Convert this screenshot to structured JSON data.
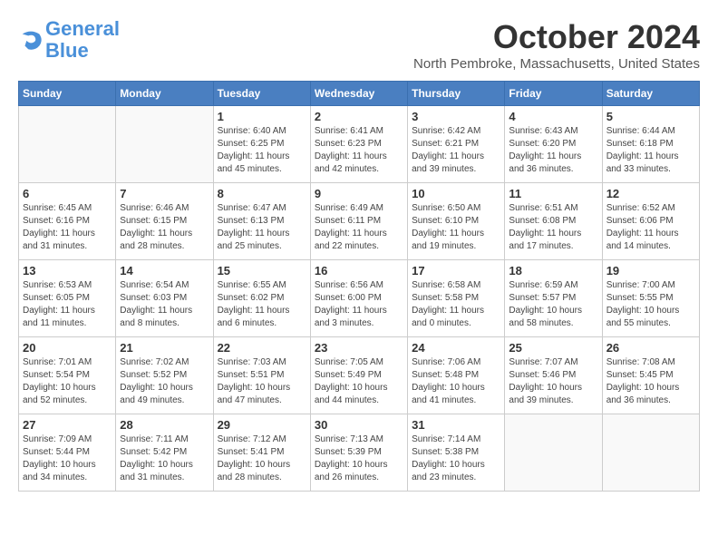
{
  "header": {
    "logo_line1": "General",
    "logo_line2": "Blue",
    "month": "October 2024",
    "location": "North Pembroke, Massachusetts, United States"
  },
  "weekdays": [
    "Sunday",
    "Monday",
    "Tuesday",
    "Wednesday",
    "Thursday",
    "Friday",
    "Saturday"
  ],
  "weeks": [
    [
      {
        "day": "",
        "info": ""
      },
      {
        "day": "",
        "info": ""
      },
      {
        "day": "1",
        "info": "Sunrise: 6:40 AM\nSunset: 6:25 PM\nDaylight: 11 hours and 45 minutes."
      },
      {
        "day": "2",
        "info": "Sunrise: 6:41 AM\nSunset: 6:23 PM\nDaylight: 11 hours and 42 minutes."
      },
      {
        "day": "3",
        "info": "Sunrise: 6:42 AM\nSunset: 6:21 PM\nDaylight: 11 hours and 39 minutes."
      },
      {
        "day": "4",
        "info": "Sunrise: 6:43 AM\nSunset: 6:20 PM\nDaylight: 11 hours and 36 minutes."
      },
      {
        "day": "5",
        "info": "Sunrise: 6:44 AM\nSunset: 6:18 PM\nDaylight: 11 hours and 33 minutes."
      }
    ],
    [
      {
        "day": "6",
        "info": "Sunrise: 6:45 AM\nSunset: 6:16 PM\nDaylight: 11 hours and 31 minutes."
      },
      {
        "day": "7",
        "info": "Sunrise: 6:46 AM\nSunset: 6:15 PM\nDaylight: 11 hours and 28 minutes."
      },
      {
        "day": "8",
        "info": "Sunrise: 6:47 AM\nSunset: 6:13 PM\nDaylight: 11 hours and 25 minutes."
      },
      {
        "day": "9",
        "info": "Sunrise: 6:49 AM\nSunset: 6:11 PM\nDaylight: 11 hours and 22 minutes."
      },
      {
        "day": "10",
        "info": "Sunrise: 6:50 AM\nSunset: 6:10 PM\nDaylight: 11 hours and 19 minutes."
      },
      {
        "day": "11",
        "info": "Sunrise: 6:51 AM\nSunset: 6:08 PM\nDaylight: 11 hours and 17 minutes."
      },
      {
        "day": "12",
        "info": "Sunrise: 6:52 AM\nSunset: 6:06 PM\nDaylight: 11 hours and 14 minutes."
      }
    ],
    [
      {
        "day": "13",
        "info": "Sunrise: 6:53 AM\nSunset: 6:05 PM\nDaylight: 11 hours and 11 minutes."
      },
      {
        "day": "14",
        "info": "Sunrise: 6:54 AM\nSunset: 6:03 PM\nDaylight: 11 hours and 8 minutes."
      },
      {
        "day": "15",
        "info": "Sunrise: 6:55 AM\nSunset: 6:02 PM\nDaylight: 11 hours and 6 minutes."
      },
      {
        "day": "16",
        "info": "Sunrise: 6:56 AM\nSunset: 6:00 PM\nDaylight: 11 hours and 3 minutes."
      },
      {
        "day": "17",
        "info": "Sunrise: 6:58 AM\nSunset: 5:58 PM\nDaylight: 11 hours and 0 minutes."
      },
      {
        "day": "18",
        "info": "Sunrise: 6:59 AM\nSunset: 5:57 PM\nDaylight: 10 hours and 58 minutes."
      },
      {
        "day": "19",
        "info": "Sunrise: 7:00 AM\nSunset: 5:55 PM\nDaylight: 10 hours and 55 minutes."
      }
    ],
    [
      {
        "day": "20",
        "info": "Sunrise: 7:01 AM\nSunset: 5:54 PM\nDaylight: 10 hours and 52 minutes."
      },
      {
        "day": "21",
        "info": "Sunrise: 7:02 AM\nSunset: 5:52 PM\nDaylight: 10 hours and 49 minutes."
      },
      {
        "day": "22",
        "info": "Sunrise: 7:03 AM\nSunset: 5:51 PM\nDaylight: 10 hours and 47 minutes."
      },
      {
        "day": "23",
        "info": "Sunrise: 7:05 AM\nSunset: 5:49 PM\nDaylight: 10 hours and 44 minutes."
      },
      {
        "day": "24",
        "info": "Sunrise: 7:06 AM\nSunset: 5:48 PM\nDaylight: 10 hours and 41 minutes."
      },
      {
        "day": "25",
        "info": "Sunrise: 7:07 AM\nSunset: 5:46 PM\nDaylight: 10 hours and 39 minutes."
      },
      {
        "day": "26",
        "info": "Sunrise: 7:08 AM\nSunset: 5:45 PM\nDaylight: 10 hours and 36 minutes."
      }
    ],
    [
      {
        "day": "27",
        "info": "Sunrise: 7:09 AM\nSunset: 5:44 PM\nDaylight: 10 hours and 34 minutes."
      },
      {
        "day": "28",
        "info": "Sunrise: 7:11 AM\nSunset: 5:42 PM\nDaylight: 10 hours and 31 minutes."
      },
      {
        "day": "29",
        "info": "Sunrise: 7:12 AM\nSunset: 5:41 PM\nDaylight: 10 hours and 28 minutes."
      },
      {
        "day": "30",
        "info": "Sunrise: 7:13 AM\nSunset: 5:39 PM\nDaylight: 10 hours and 26 minutes."
      },
      {
        "day": "31",
        "info": "Sunrise: 7:14 AM\nSunset: 5:38 PM\nDaylight: 10 hours and 23 minutes."
      },
      {
        "day": "",
        "info": ""
      },
      {
        "day": "",
        "info": ""
      }
    ]
  ]
}
